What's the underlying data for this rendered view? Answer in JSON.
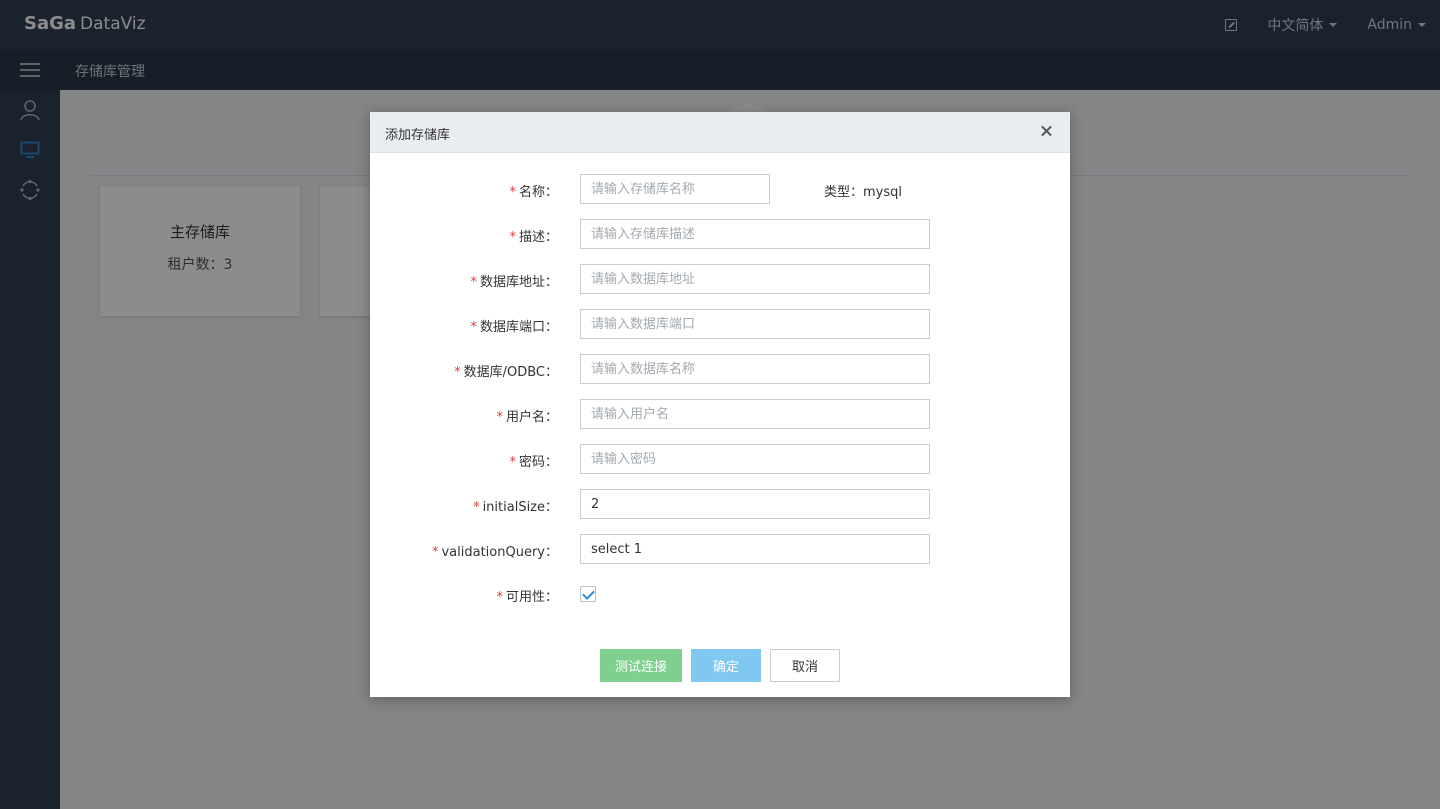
{
  "app": {
    "logo_sa": "Sa",
    "logo_ga": "Ga",
    "logo_dataviz": "DataViz"
  },
  "topbar": {
    "language": "中文简体",
    "user": "Admin"
  },
  "breadcrumb": "存储库管理",
  "cards": [
    {
      "title": "主存储库",
      "count_label": "租户数：3"
    }
  ],
  "modal": {
    "title": "添加存储库",
    "type_label": "类型：",
    "type_value": "mysql",
    "fields": {
      "name": {
        "label": "名称：",
        "placeholder": "请输入存储库名称",
        "value": ""
      },
      "desc": {
        "label": "描述：",
        "placeholder": "请输入存储库描述",
        "value": ""
      },
      "address": {
        "label": "数据库地址：",
        "placeholder": "请输入数据库地址",
        "value": ""
      },
      "port": {
        "label": "数据库端口：",
        "placeholder": "请输入数据库端口",
        "value": ""
      },
      "db": {
        "label": "数据库/ODBC：",
        "placeholder": "请输入数据库名称",
        "value": ""
      },
      "username": {
        "label": "用户名：",
        "placeholder": "请输入用户名",
        "value": ""
      },
      "password": {
        "label": "密码：",
        "placeholder": "请输入密码",
        "value": ""
      },
      "initial_size": {
        "label": "initialSize：",
        "placeholder": "",
        "value": "2"
      },
      "validation_query": {
        "label": "validationQuery：",
        "placeholder": "",
        "value": "select 1"
      },
      "availability": {
        "label": "可用性：",
        "checked": true
      }
    },
    "buttons": {
      "test": "测试连接",
      "ok": "确定",
      "cancel": "取消"
    }
  },
  "colors": {
    "topbar": "#2f3e52",
    "subbar": "#2a384a",
    "required": "#e4393c",
    "test_btn": "#7fd08f",
    "ok_btn": "#80c8f2",
    "accent": "#2b8ed6"
  }
}
